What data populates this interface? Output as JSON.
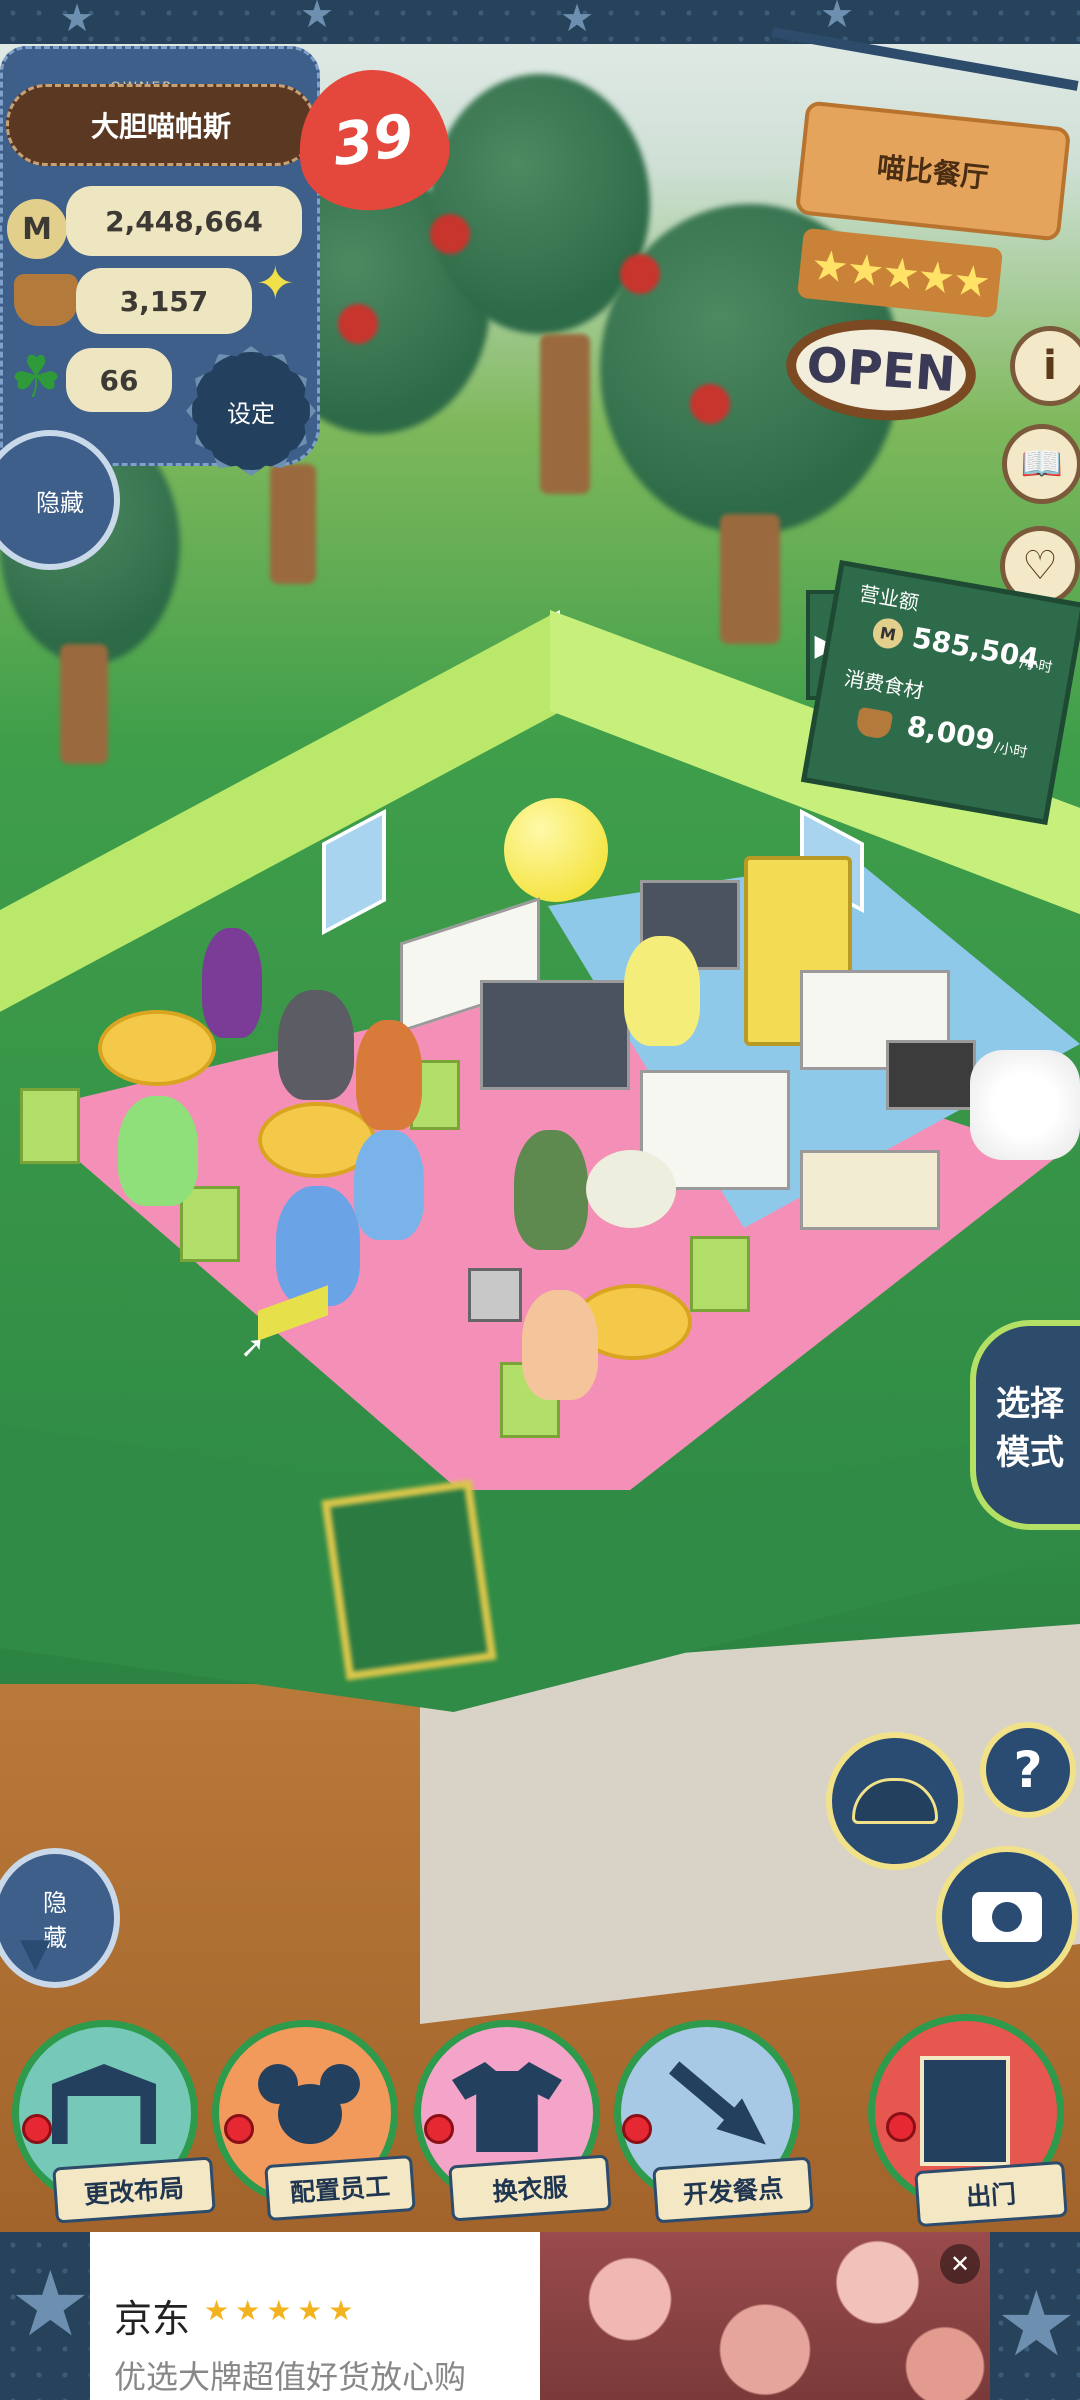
{
  "owner": {
    "tag": "OWNER",
    "name": "大胆喵帕斯",
    "coins": "2,448,664",
    "ingredients": "3,157",
    "clovers": "66",
    "level": "39",
    "settings_label": "设定",
    "hide_label": "隐藏"
  },
  "restaurant": {
    "name": "喵比餐厅",
    "stars": "★★★★★",
    "status": "OPEN"
  },
  "side_icons": [
    "i",
    "📖",
    "♡"
  ],
  "income": {
    "revenue_label": "营业额",
    "revenue_value": "585,504",
    "revenue_unit": "/小时",
    "consumption_label": "消费食材",
    "consumption_value": "8,009",
    "consumption_unit": "/小时",
    "toggle_arrow": "▶"
  },
  "mode_button": {
    "label": "选择模式"
  },
  "controls": {
    "help": "?",
    "hide_bottom_label": "隐藏"
  },
  "actions": [
    {
      "label": "更改布局",
      "color": "#76c8b8"
    },
    {
      "label": "配置员工",
      "color": "#f29a5c"
    },
    {
      "label": "换衣服",
      "color": "#f4a4c8"
    },
    {
      "label": "开发餐点",
      "color": "#a7c9e6"
    },
    {
      "label": "出门",
      "color": "#e5574f"
    }
  ],
  "ad": {
    "brand": "京东",
    "rating": "★★★★★",
    "tagline": "优选大牌超值好货放心购",
    "close": "✕"
  },
  "colors": {
    "accent_green": "#2e9a4c",
    "fabric_blue": "#27435c",
    "pin_red": "#e62833"
  }
}
